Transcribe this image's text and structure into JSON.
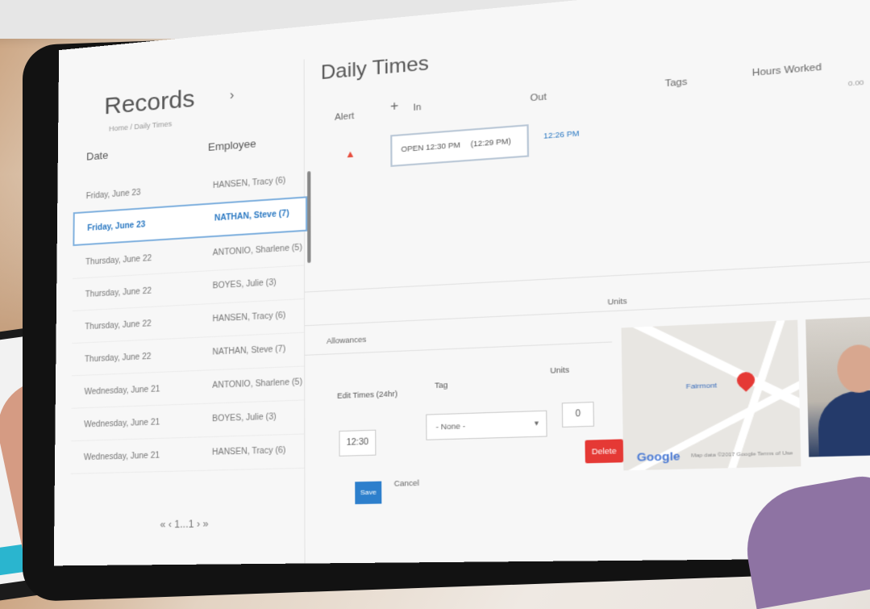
{
  "records": {
    "title": "Records",
    "chevron": "›",
    "breadcrumb": "Home / Daily Times",
    "col_date": "Date",
    "col_employee": "Employee",
    "rows": [
      {
        "date": "Friday, June 23",
        "employee": "HANSEN, Tracy (6)"
      },
      {
        "date": "Friday, June 23",
        "employee": "NATHAN, Steve (7)"
      },
      {
        "date": "Thursday, June 22",
        "employee": "ANTONIO, Sharlene (5)"
      },
      {
        "date": "Thursday, June 22",
        "employee": "BOYES, Julie (3)"
      },
      {
        "date": "Thursday, June 22",
        "employee": "HANSEN, Tracy (6)"
      },
      {
        "date": "Thursday, June 22",
        "employee": "NATHAN, Steve (7)"
      },
      {
        "date": "Wednesday, June 21",
        "employee": "ANTONIO, Sharlene (5)"
      },
      {
        "date": "Wednesday, June 21",
        "employee": "BOYES, Julie (3)"
      },
      {
        "date": "Wednesday, June 21",
        "employee": "HANSEN, Tracy (6)"
      }
    ],
    "pager": "« ‹ 1...1 › »"
  },
  "daily": {
    "title": "Daily Times",
    "headers": {
      "alert": "Alert",
      "add": "+",
      "in": "In",
      "out": "Out",
      "tags": "Tags",
      "hours": "Hours Worked"
    },
    "alert_icon": "▲",
    "punch_in": "OPEN 12:30 PM",
    "punch_in_edit": "(12:29 PM)",
    "punch_out": "12:26 PM",
    "hours_value": "0.00",
    "units_header": "Units",
    "allowances": "Allowances",
    "edit_times_label": "Edit Times (24hr)",
    "tag_label": "Tag",
    "units_label": "Units",
    "time_value": "12:30",
    "tag_select_value": "- None -",
    "units_value": "0",
    "delete_label": "Delete",
    "save_label": "Save",
    "cancel_label": "Cancel"
  },
  "map": {
    "poi_label": "Fairmont",
    "google_logo": "Google",
    "terms": "Map data ©2017 Google  Terms of Use"
  },
  "colors": {
    "accent": "#2d7fcc",
    "danger": "#e53935",
    "selected_border": "#7fb0de"
  }
}
